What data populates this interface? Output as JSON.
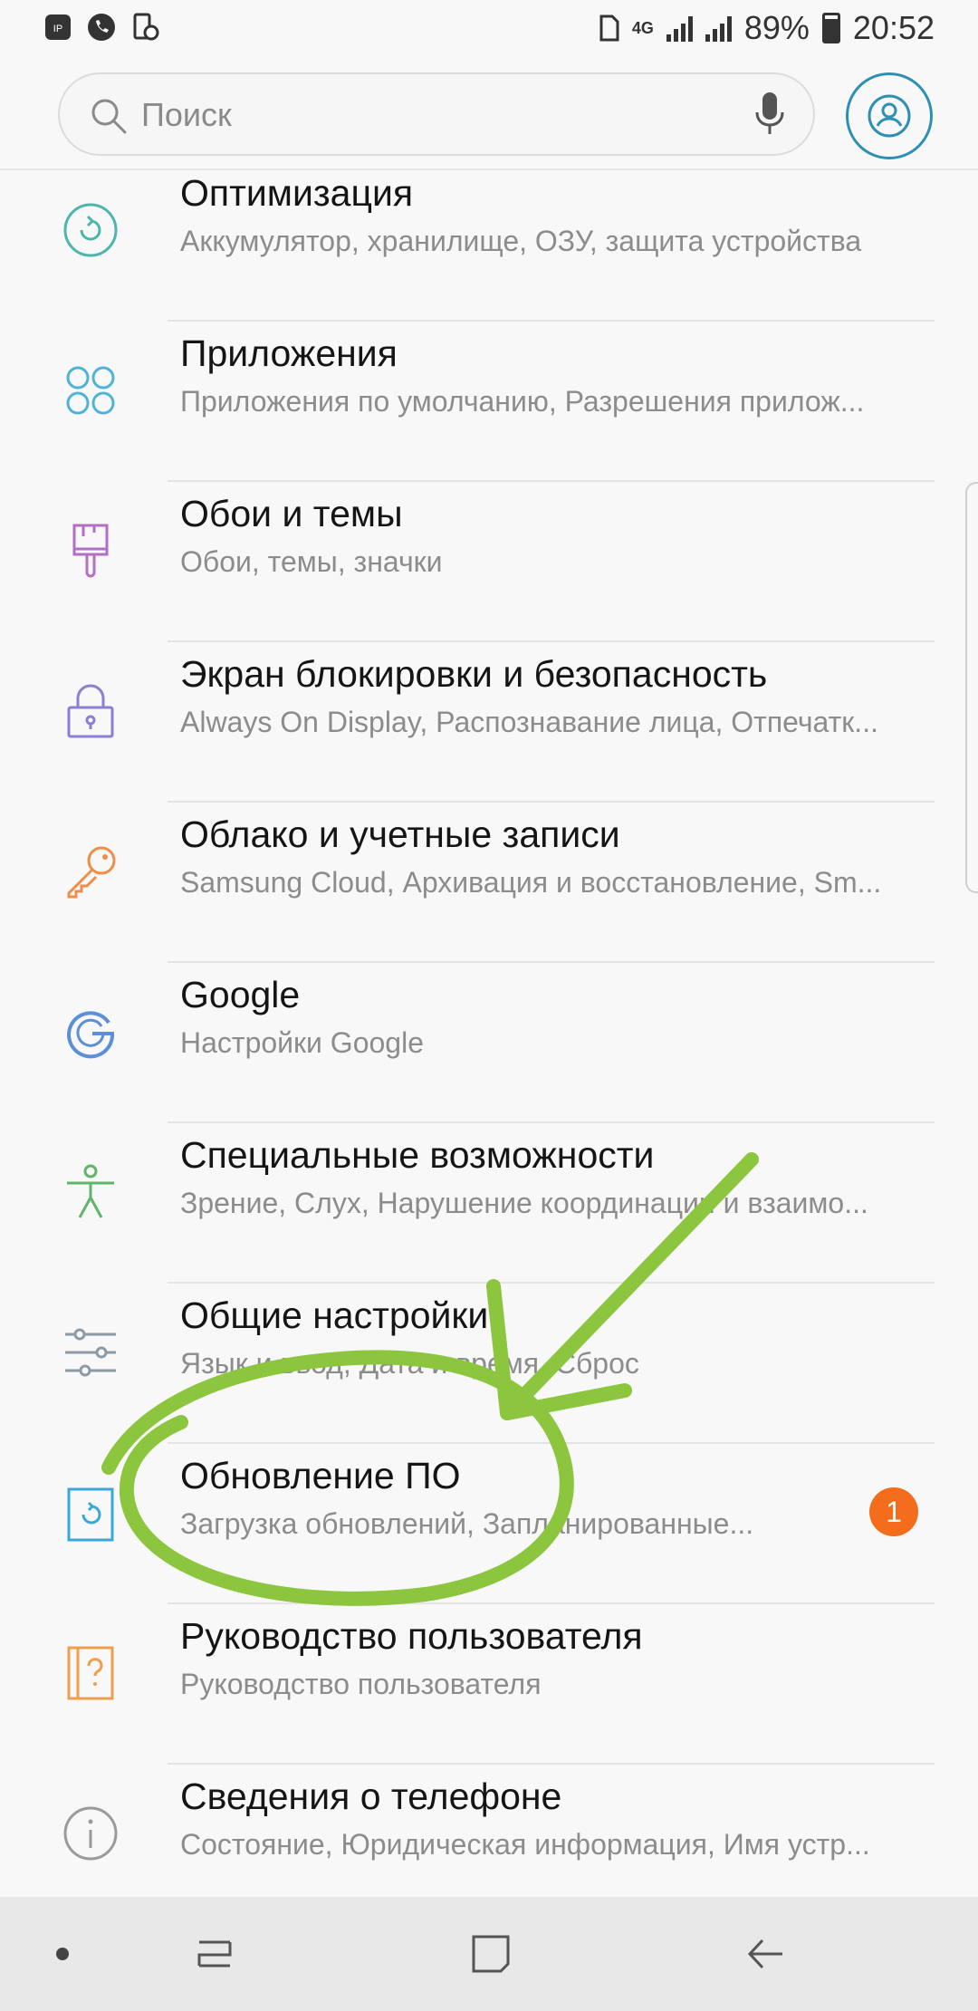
{
  "status_bar": {
    "network": "4G",
    "battery_percent": "89%",
    "time": "20:52"
  },
  "search": {
    "placeholder": "Поиск"
  },
  "settings_items": [
    {
      "title": "Оптимизация",
      "subtitle": "Аккумулятор, хранилище, ОЗУ, защита устройства",
      "icon": "optimization-icon",
      "color": "#4db6ac"
    },
    {
      "title": "Приложения",
      "subtitle": "Приложения по умолчанию, Разрешения прилож...",
      "icon": "apps-icon",
      "color": "#4fb3d9"
    },
    {
      "title": "Обои и темы",
      "subtitle": "Обои, темы, значки",
      "icon": "paintbrush-icon",
      "color": "#b16fc6"
    },
    {
      "title": "Экран блокировки и безопасность",
      "subtitle": "Always On Display, Распознавание лица, Отпечатк...",
      "icon": "lock-icon",
      "color": "#8b7fd1"
    },
    {
      "title": "Облако и учетные записи",
      "subtitle": "Samsung Cloud, Архивация и восстановление, Sm...",
      "icon": "key-icon",
      "color": "#ef8d4b"
    },
    {
      "title": "Google",
      "subtitle": "Настройки Google",
      "icon": "google-icon",
      "color": "#5c8fd6"
    },
    {
      "title": "Специальные возможности",
      "subtitle": "Зрение, Слух, Нарушение координации и взаимо...",
      "icon": "accessibility-icon",
      "color": "#5fb56a"
    },
    {
      "title": "Общие настройки",
      "subtitle": "Язык и ввод, Дата и время, Сброс",
      "icon": "sliders-icon",
      "color": "#8e9aa5"
    },
    {
      "title": "Обновление ПО",
      "subtitle": "Загрузка обновлений, Запланированные...",
      "icon": "software-update-icon",
      "color": "#3aa7d6",
      "badge": "1"
    },
    {
      "title": "Руководство пользователя",
      "subtitle": "Руководство пользователя",
      "icon": "help-book-icon",
      "color": "#ef9e4b"
    },
    {
      "title": "Сведения о телефоне",
      "subtitle": "Состояние, Юридическая информация, Имя устр...",
      "icon": "info-icon",
      "color": "#9a9a9a"
    }
  ],
  "colors": {
    "badge": "#f36d1d",
    "annotation": "#8cc63f",
    "account_ring": "#2e8fb4"
  }
}
